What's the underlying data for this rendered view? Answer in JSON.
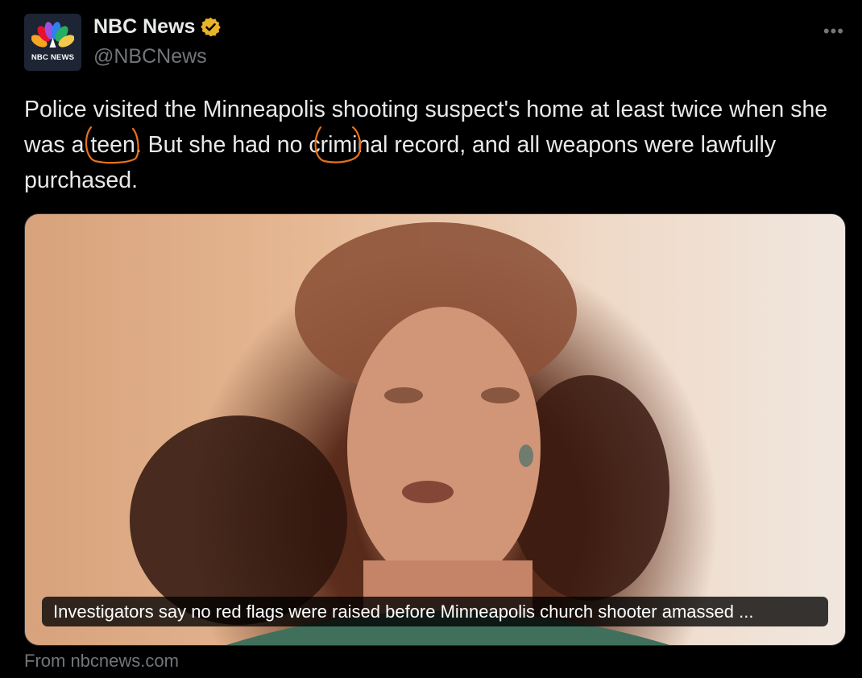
{
  "account": {
    "logo_text": "NBC NEWS",
    "name": "NBC News",
    "handle": "@NBCNews",
    "verified_color": "#e8b22a"
  },
  "menu": {
    "more_label": "•••"
  },
  "tweet": {
    "part1": "Police visited the Minneapolis shooting suspect's home at least twice when ",
    "highlight1": "she",
    "part2": " was a teen. But ",
    "highlight2": "she",
    "part3": " had no criminal record, and all weapons were lawfully purchased."
  },
  "card": {
    "caption": "Investigators say no red flags were raised before Minneapolis church shooter amassed ...",
    "source": "From nbcnews.com"
  },
  "colors": {
    "annotation": "#e8711a",
    "background": "#000000",
    "text": "#e7e9ea",
    "muted": "#71767b"
  }
}
